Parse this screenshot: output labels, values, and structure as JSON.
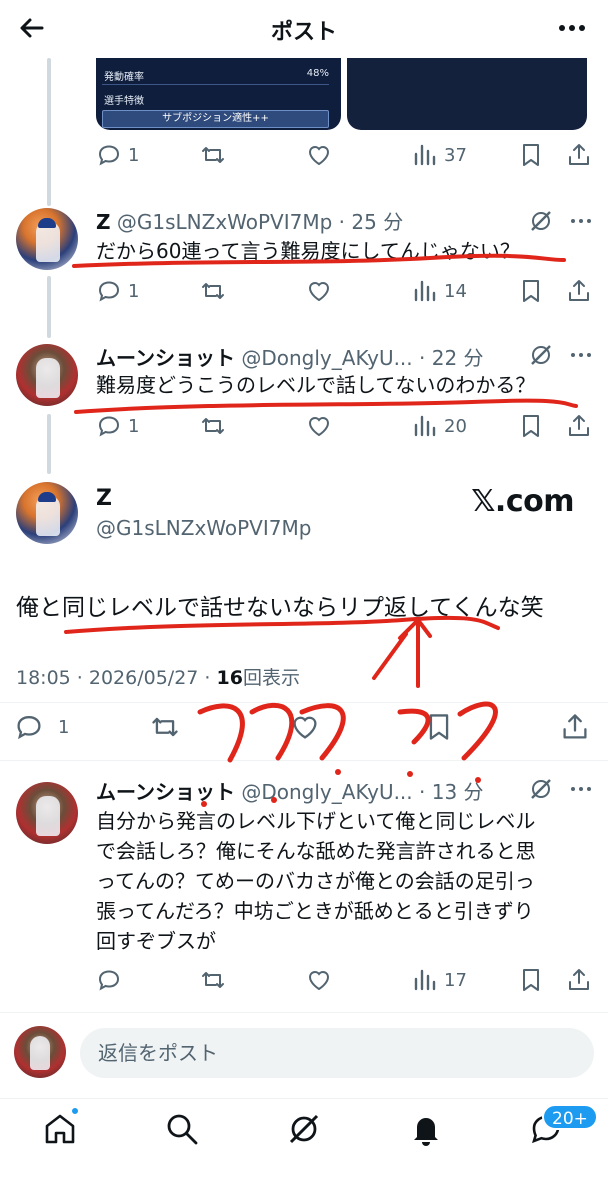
{
  "header": {
    "title": "ポスト",
    "back_icon": "arrow-left-icon",
    "more_icon": "more-horizontal-icon"
  },
  "media": {
    "left": {
      "row1_label": "発動確率",
      "row1_value": "48%",
      "row2_label": "選手特徴",
      "bar_label": "サブポジション適性++"
    }
  },
  "prev_post_actions": {
    "replies": "1",
    "views": "37"
  },
  "replies_above": [
    {
      "name": "Z",
      "handle": "@G1sLNZxWoPVI7Mp",
      "time": "25 分",
      "text": "だから60連って言う難易度にしてんじゃない？",
      "replies": "1",
      "views": "14"
    },
    {
      "name": "ムーンショット",
      "handle": "@Dongly_AKyU...",
      "time": "22 分",
      "text": "難易度どうこうのレベルで話してないのわかる？",
      "replies": "1",
      "views": "20"
    }
  ],
  "main_post": {
    "name": "Z",
    "handle": "@G1sLNZxWoPVI7Mp",
    "source_label": "𝕏.com",
    "text": "俺と同じレベルで話せないならリプ返してくんな笑",
    "datetime": "18:05 · 2026/05/27 · ",
    "view_count": "16",
    "view_label": "回表示",
    "replies": "1"
  },
  "reply_below": {
    "name": "ムーンショット",
    "handle": "@Dongly_AKyU...",
    "time": "13 分",
    "lines": [
      "自分から発言のレベル下げといて俺と同じレベル",
      "で会話しろ？俺にそんな舐めた発言許されると思",
      "ってんの？てめーのバカさが俺との会話の足引っ",
      "張ってんだろ？中坊ごときが舐めとると引きずり",
      "回すぞブスが"
    ],
    "replies": "",
    "views": "17"
  },
  "compose": {
    "placeholder": "返信をポスト"
  },
  "tabs": {
    "home": "home-icon",
    "search": "search-icon",
    "grok": "grok-icon",
    "notifications": "bell-icon",
    "messages": "message-icon",
    "messages_badge": "20+"
  },
  "annotation_color": "#e0261b"
}
